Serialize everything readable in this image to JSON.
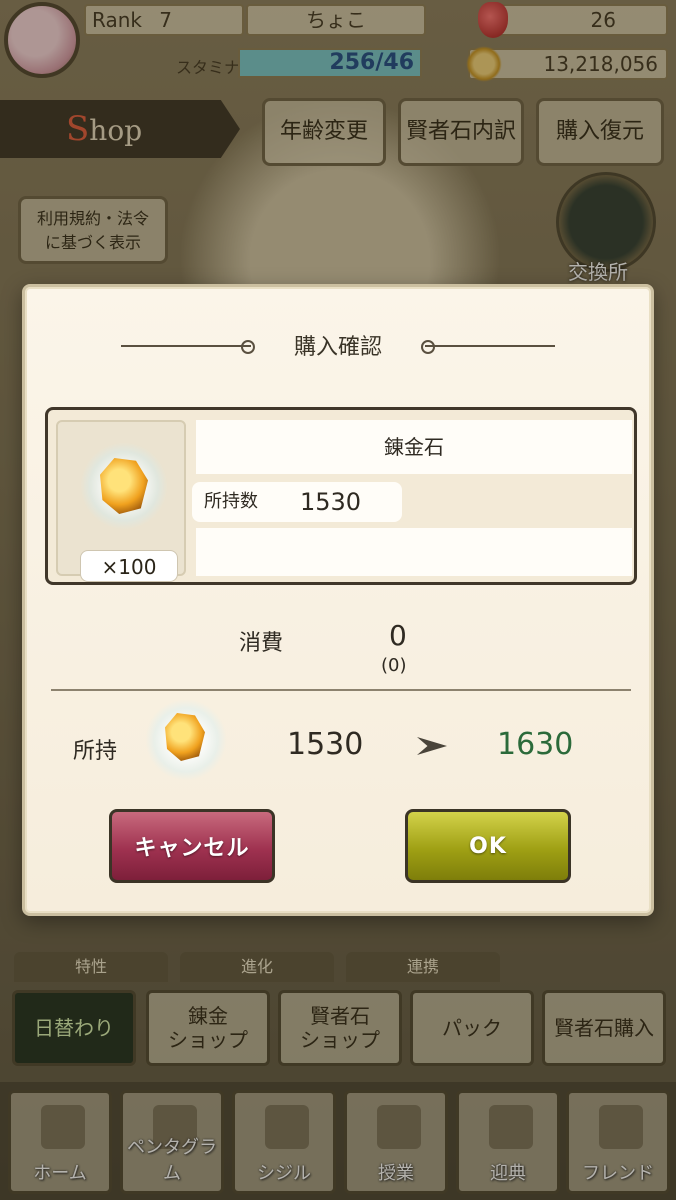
{
  "status": {
    "rank_label": "Rank",
    "rank_value": "7",
    "player_name": "ちょこ",
    "gems": "26",
    "stamina_label": "スタミナ",
    "stamina": "256/46",
    "stamina_fill_fraction": 1.0,
    "gold": "13,218,056"
  },
  "header": {
    "shop_title_initial": "S",
    "shop_title_rest": "hop",
    "buttons": [
      "年齢変更",
      "賢者石内訳",
      "購入復元"
    ],
    "legal_line1": "利用規約・法令",
    "legal_line2": "に基づく表示",
    "exchange_label": "交換所"
  },
  "dialog": {
    "title": "購入確認",
    "item": {
      "name": "錬金石",
      "quantity_badge": "×100",
      "owned_label": "所持数",
      "owned_value": "1530"
    },
    "cost": {
      "label": "消費",
      "value": "0",
      "sub_value": "(0)"
    },
    "holding": {
      "label": "所持",
      "from": "1530",
      "to": "1630"
    },
    "cancel_label": "キャンセル",
    "ok_label": "OK"
  },
  "categories": [
    "特性",
    "進化",
    "連携"
  ],
  "shop_buttons": [
    {
      "label": "日替わり"
    },
    {
      "label": "錬金\nショップ"
    },
    {
      "label": "賢者石\nショップ"
    },
    {
      "label": "パック"
    },
    {
      "label": "賢者石購入"
    }
  ],
  "nav": [
    "ホーム",
    "ペンタグラム",
    "シジル",
    "授業",
    "迎典",
    "フレンド"
  ],
  "colors": {
    "cancel_button": "#9f3250",
    "ok_button": "#9fa014",
    "result_value": "#2b6a3a"
  }
}
